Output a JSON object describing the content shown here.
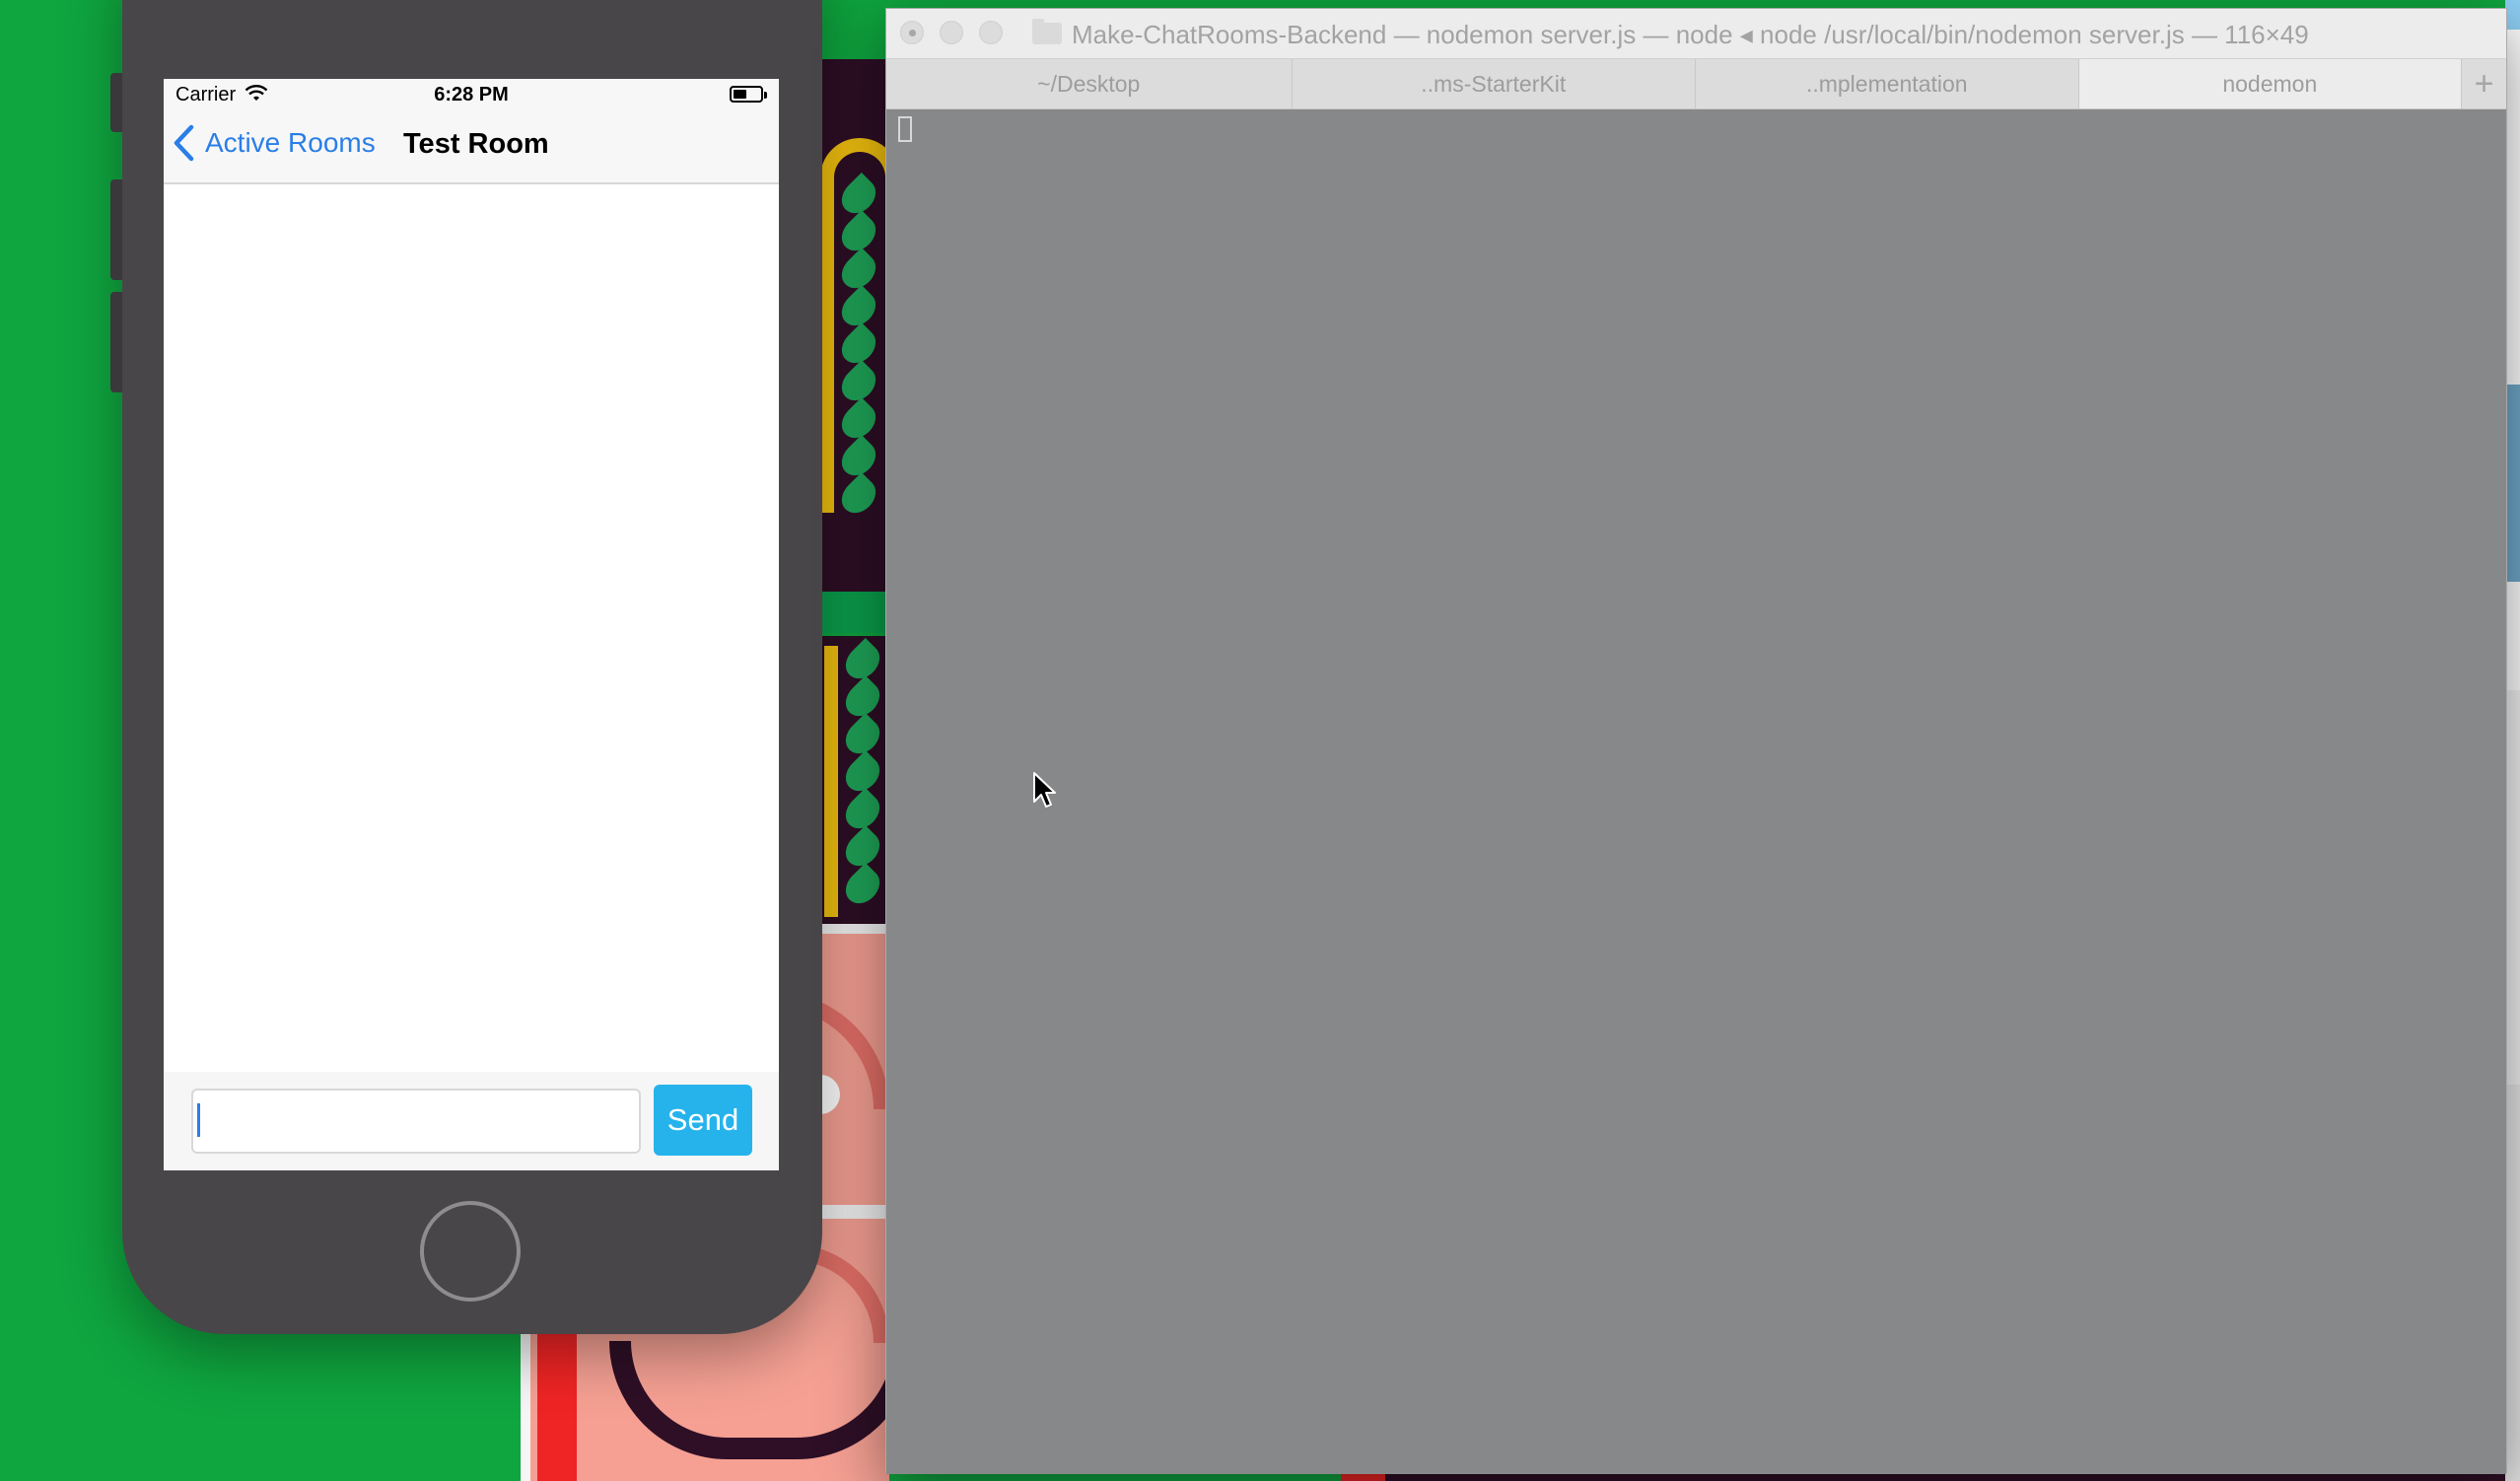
{
  "simulator": {
    "status_bar": {
      "carrier": "Carrier",
      "time": "6:28 PM",
      "wifi_icon": "wifi-icon",
      "battery_icon": "battery-icon"
    },
    "nav_bar": {
      "back_label": "Active Rooms",
      "back_icon": "chevron-left-icon",
      "title": "Test Room"
    },
    "composer": {
      "input_value": "",
      "send_label": "Send"
    },
    "colors": {
      "tint": "#2a7ee7",
      "send_button": "#26b3ec"
    }
  },
  "terminal": {
    "title": "Make-ChatRooms-Backend — nodemon server.js — node ◂ node /usr/local/bin/nodemon server.js — 116×49",
    "tabs": [
      {
        "label": "~/Desktop",
        "active": false
      },
      {
        "label": "..ms-StarterKit",
        "active": false
      },
      {
        "label": "..mplementation",
        "active": false
      },
      {
        "label": "nodemon",
        "active": true
      }
    ],
    "new_tab_label": "+",
    "output": ""
  }
}
